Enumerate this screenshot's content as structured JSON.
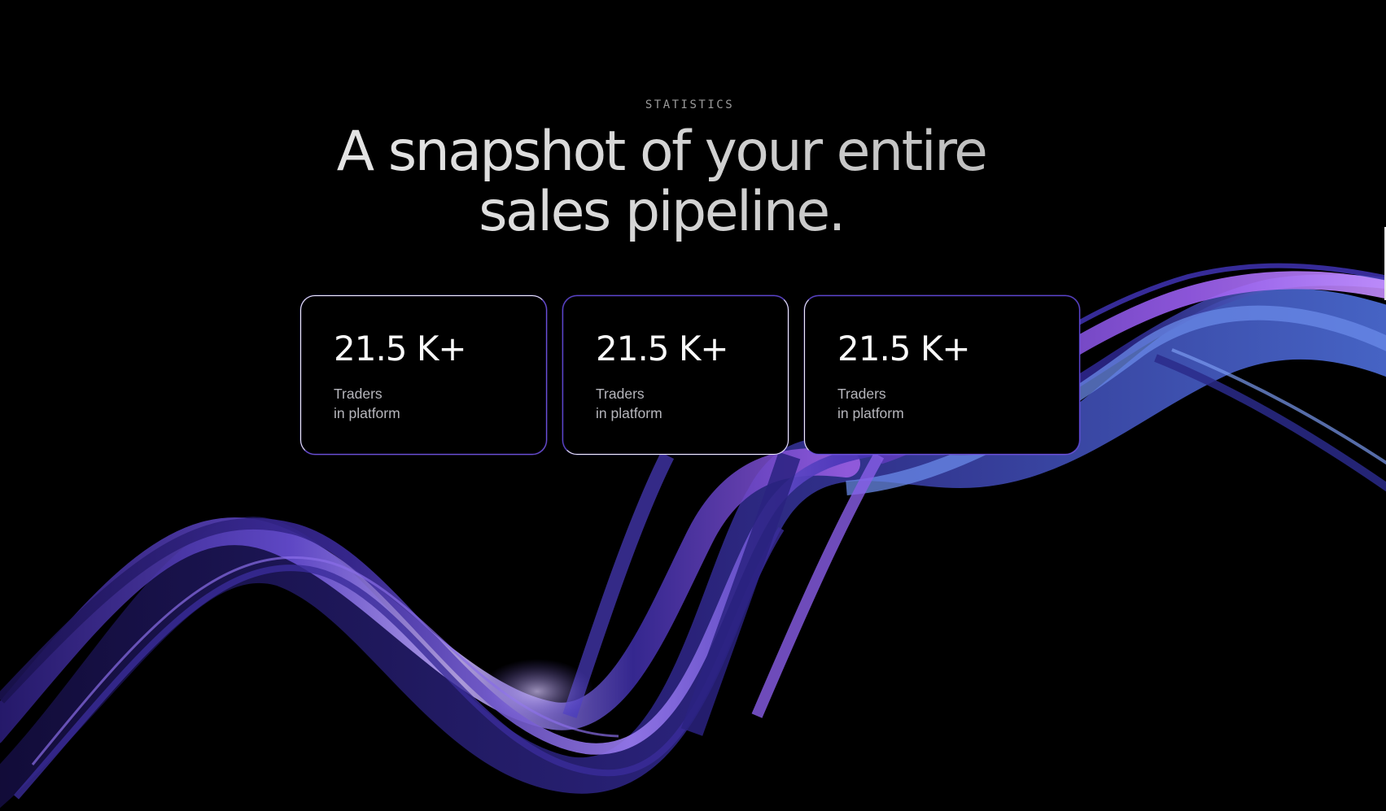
{
  "section": {
    "eyebrow": "STATISTICS",
    "headline_line1": "A snapshot of your entire",
    "headline_line2": "sales pipeline."
  },
  "stats": [
    {
      "value": "21.5 K+",
      "label_line1": "Traders",
      "label_line2": "in platform"
    },
    {
      "value": "21.5 K+",
      "label_line1": "Traders",
      "label_line2": "in platform"
    },
    {
      "value": "21.5 K+",
      "label_line1": "Traders",
      "label_line2": "in platform"
    }
  ],
  "colors": {
    "background": "#000000",
    "ribbon_purple": "#7b4fe0",
    "ribbon_violet": "#a86cf0",
    "ribbon_blue": "#5b7fe0",
    "ribbon_deep": "#2a1f7a",
    "card_border": "#f0f0f4",
    "card_accent": "#6a4fd8",
    "muted_text": "#b6b6bc"
  }
}
